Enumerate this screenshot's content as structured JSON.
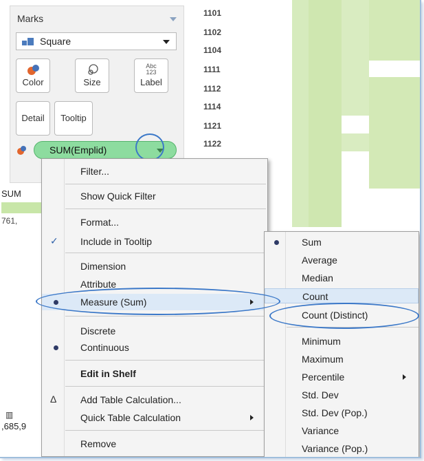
{
  "marks": {
    "header": "Marks",
    "mark_type": "Square",
    "buttons": {
      "color": "Color",
      "size": "Size",
      "label": "Label",
      "label_icon_text": "Abc\n123",
      "detail": "Detail",
      "tooltip": "Tooltip"
    },
    "pill": "SUM(Emplid)"
  },
  "legend": {
    "title": "SUM",
    "value": "761,",
    "bottom_value": ",685,9"
  },
  "rows": [
    "1101",
    "1102",
    "1104",
    "1111",
    "1112",
    "1114",
    "1121",
    "1122"
  ],
  "context_menu": {
    "items": [
      {
        "label": "Filter..."
      },
      {
        "label": "Show Quick Filter"
      },
      {
        "label": "Format..."
      },
      {
        "label": "Include in Tooltip",
        "check": "✓"
      },
      {
        "label": "Dimension"
      },
      {
        "label": "Attribute"
      },
      {
        "label": "Measure (Sum)"
      },
      {
        "label": "Discrete"
      },
      {
        "label": "Continuous"
      },
      {
        "label": "Edit in Shelf"
      },
      {
        "label": "Add Table Calculation...",
        "icon": "Δ"
      },
      {
        "label": "Quick Table Calculation"
      },
      {
        "label": "Remove"
      }
    ]
  },
  "sub_menu": {
    "items": [
      "Sum",
      "Average",
      "Median",
      "Count",
      "Count (Distinct)",
      "Minimum",
      "Maximum",
      "Percentile",
      "Std. Dev",
      "Std. Dev (Pop.)",
      "Variance",
      "Variance (Pop.)"
    ]
  },
  "colors": {
    "pill_green": "#8ddc9f",
    "heat_light": "#d9ecc1",
    "heat_dark": "#c9e6a6",
    "highlight_blue": "#3b78c8",
    "radio_dot": "#2e3a66"
  }
}
